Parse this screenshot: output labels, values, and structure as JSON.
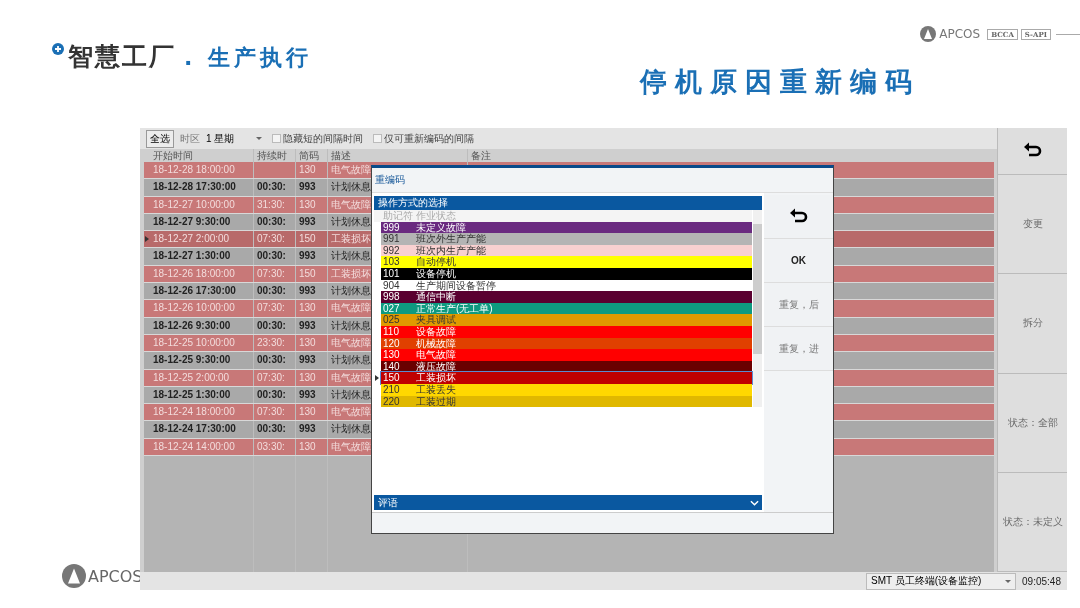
{
  "slide": {
    "title": "智慧工厂",
    "title_suffix": ". 生产执行",
    "heading": "停机原因重新编码",
    "logo": {
      "name": "APCOS",
      "badges": [
        "BCCA",
        "S-API"
      ]
    },
    "footer_logo": "APCOS"
  },
  "toolbar": {
    "select_all": "全选",
    "timezone_label": "时区",
    "period": "1 星期",
    "checkboxes": [
      {
        "label": "隐藏短的间隔时间",
        "checked": false
      },
      {
        "label": "仅可重新编码的间隔",
        "checked": false
      }
    ]
  },
  "table": {
    "columns": [
      "开始时间",
      "持续时",
      "简码",
      "描述",
      "备注"
    ],
    "rows": [
      {
        "kind": "fault",
        "selected": false,
        "start": "18-12-28 18:00:00",
        "code": "130",
        "description": "电气故障"
      },
      {
        "kind": "break",
        "selected": false,
        "start": "18-12-28 17:30:00",
        "duration": "00:30:",
        "code": "993",
        "description": "计划休息"
      },
      {
        "kind": "fault",
        "selected": false,
        "start": "18-12-27 10:00:00",
        "duration": "31:30:",
        "code": "130",
        "description": "电气故障"
      },
      {
        "kind": "break",
        "selected": false,
        "start": "18-12-27 9:30:00",
        "duration": "00:30:",
        "code": "993",
        "description": "计划休息"
      },
      {
        "kind": "fault",
        "selected": true,
        "start": "18-12-27 2:00:00",
        "duration": "07:30:",
        "code": "150",
        "description": "工装损坏"
      },
      {
        "kind": "break",
        "selected": false,
        "start": "18-12-27 1:30:00",
        "duration": "00:30:",
        "code": "993",
        "description": "计划休息"
      },
      {
        "kind": "fault",
        "selected": false,
        "start": "18-12-26 18:00:00",
        "duration": "07:30:",
        "code": "150",
        "description": "工装损坏"
      },
      {
        "kind": "break",
        "selected": false,
        "start": "18-12-26 17:30:00",
        "duration": "00:30:",
        "code": "993",
        "description": "计划休息"
      },
      {
        "kind": "fault",
        "selected": false,
        "start": "18-12-26 10:00:00",
        "duration": "07:30:",
        "code": "130",
        "description": "电气故障"
      },
      {
        "kind": "break",
        "selected": false,
        "start": "18-12-26 9:30:00",
        "duration": "00:30:",
        "code": "993",
        "description": "计划休息"
      },
      {
        "kind": "fault",
        "selected": false,
        "start": "18-12-25 10:00:00",
        "duration": "23:30:",
        "code": "130",
        "description": "电气故障"
      },
      {
        "kind": "break",
        "selected": false,
        "start": "18-12-25 9:30:00",
        "duration": "00:30:",
        "code": "993",
        "description": "计划休息"
      },
      {
        "kind": "fault",
        "selected": false,
        "start": "18-12-25 2:00:00",
        "duration": "07:30:",
        "code": "130",
        "description": "电气故障"
      },
      {
        "kind": "break",
        "selected": false,
        "start": "18-12-25 1:30:00",
        "duration": "00:30:",
        "code": "993",
        "description": "计划休息"
      },
      {
        "kind": "fault",
        "selected": false,
        "start": "18-12-24 18:00:00",
        "duration": "07:30:",
        "code": "130",
        "description": "电气故障"
      },
      {
        "kind": "break",
        "selected": false,
        "start": "18-12-24 17:30:00",
        "duration": "00:30:",
        "code": "993",
        "description": "计划休息"
      },
      {
        "kind": "fault",
        "selected": false,
        "start": "18-12-24 14:00:00",
        "duration": "03:30:",
        "code": "130",
        "description": "电气故障"
      }
    ]
  },
  "dialog": {
    "title": "重编码",
    "section": "操作方式的选择",
    "columns": [
      "助记符",
      "作业状态"
    ],
    "items": [
      {
        "code": "999",
        "label": "未定义故障",
        "color": "#6a2a80",
        "selected": false
      },
      {
        "code": "991",
        "label": "班次外生产产能",
        "color": "#b4b4b4",
        "selected": false
      },
      {
        "code": "992",
        "label": "班次内生产产能",
        "color": "#f8d0d0",
        "selected": false
      },
      {
        "code": "103",
        "label": "自动停机",
        "color": "#ffff00",
        "selected": false
      },
      {
        "code": "101",
        "label": "设备停机",
        "color": "#000000",
        "selected": false
      },
      {
        "code": "904",
        "label": "生产期间设备暂停",
        "color": "#ffffff",
        "selected": false
      },
      {
        "code": "998",
        "label": "通信中断",
        "color": "#5a0030",
        "selected": false
      },
      {
        "code": "027",
        "label": "正常生产(无工单)",
        "color": "#0e9a80",
        "selected": false
      },
      {
        "code": "025",
        "label": "夹具调试",
        "color": "#e09a00",
        "selected": false
      },
      {
        "code": "110",
        "label": "设备故障",
        "color": "#ff0000",
        "selected": false
      },
      {
        "code": "120",
        "label": "机械故障",
        "color": "#e04000",
        "selected": false
      },
      {
        "code": "130",
        "label": "电气故障",
        "color": "#ff0000",
        "selected": false
      },
      {
        "code": "140",
        "label": "液压故障",
        "color": "#6a0000",
        "selected": false
      },
      {
        "code": "150",
        "label": "工装损坏",
        "color": "#c00000",
        "selected": true
      },
      {
        "code": "210",
        "label": "工装丢失",
        "color": "#ffd800",
        "selected": false
      },
      {
        "code": "220",
        "label": "工装过期",
        "color": "#e0b800",
        "selected": false
      }
    ],
    "comment": "评语",
    "buttons": [
      {
        "kind": "undo",
        "disabled": false
      },
      {
        "kind": "text",
        "label": "OK",
        "disabled": false
      },
      {
        "kind": "text",
        "label": "重复，后",
        "disabled": true
      },
      {
        "kind": "text",
        "label": "重复，进",
        "disabled": true
      }
    ]
  },
  "sidebar": {
    "buttons": [
      {
        "kind": "undo",
        "disabled": false
      },
      {
        "kind": "text",
        "label": "变更",
        "disabled": true
      },
      {
        "kind": "text",
        "label": "拆分",
        "disabled": true
      },
      {
        "kind": "text",
        "label": "状态：全部",
        "disabled": true
      },
      {
        "kind": "text",
        "label": "状态：未定义",
        "disabled": true
      }
    ]
  },
  "status_bar": {
    "terminal": "SMT 员工终端(设备监控)",
    "time": "09:05:48"
  }
}
